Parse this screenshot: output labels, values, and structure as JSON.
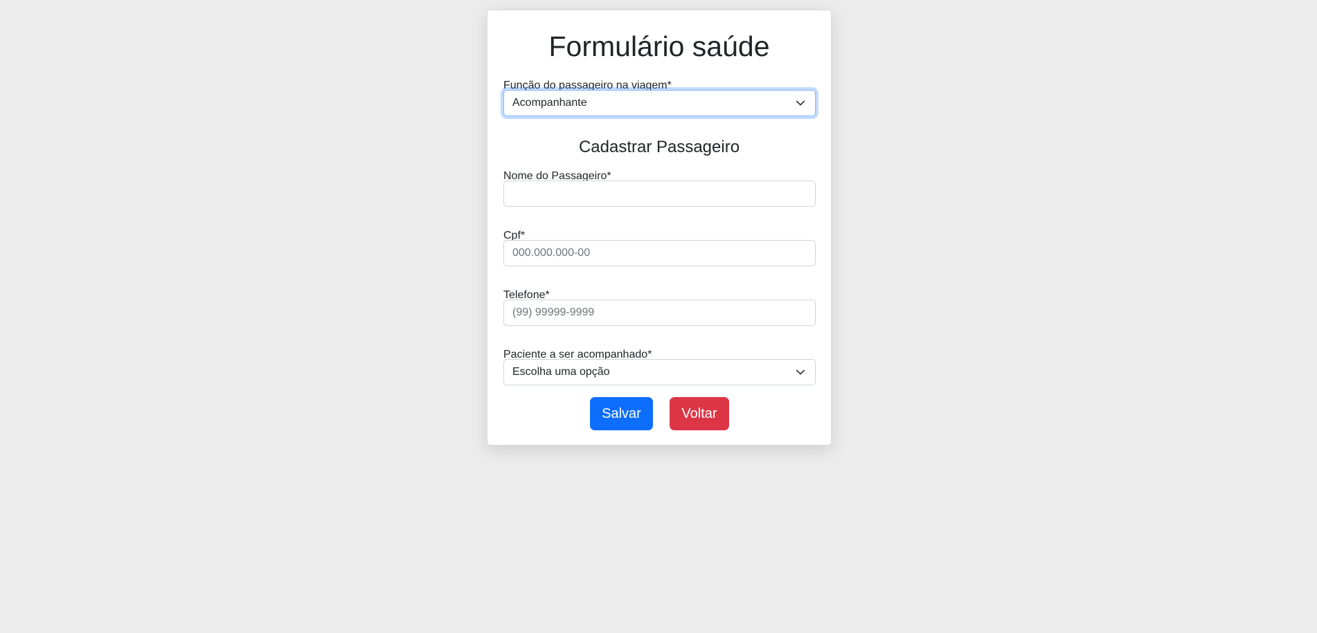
{
  "form": {
    "title": "Formulário saúde",
    "role_label": "Função do passageiro na viagem*",
    "role_value": "Acompanhante",
    "section_title": "Cadastrar Passageiro",
    "name_label": "Nome do Passageiro*",
    "name_value": "",
    "name_placeholder": "",
    "cpf_label": "Cpf*",
    "cpf_placeholder": "000.000.000-00",
    "phone_label": "Telefone*",
    "phone_placeholder": "(99) 99999-9999",
    "patient_label": "Paciente a ser acompanhado*",
    "patient_value": "Escolha uma opção",
    "save_label": "Salvar",
    "back_label": "Voltar"
  },
  "icons": {
    "role_select_icon": "chevron-down-icon",
    "patient_select_icon": "chevron-down-icon"
  },
  "colors": {
    "background": "#ececec",
    "card": "#ffffff",
    "primary": "#0d6efd",
    "danger": "#dc3545",
    "focus_border": "#86b7fe",
    "text": "#212529",
    "placeholder": "#6c757d"
  }
}
